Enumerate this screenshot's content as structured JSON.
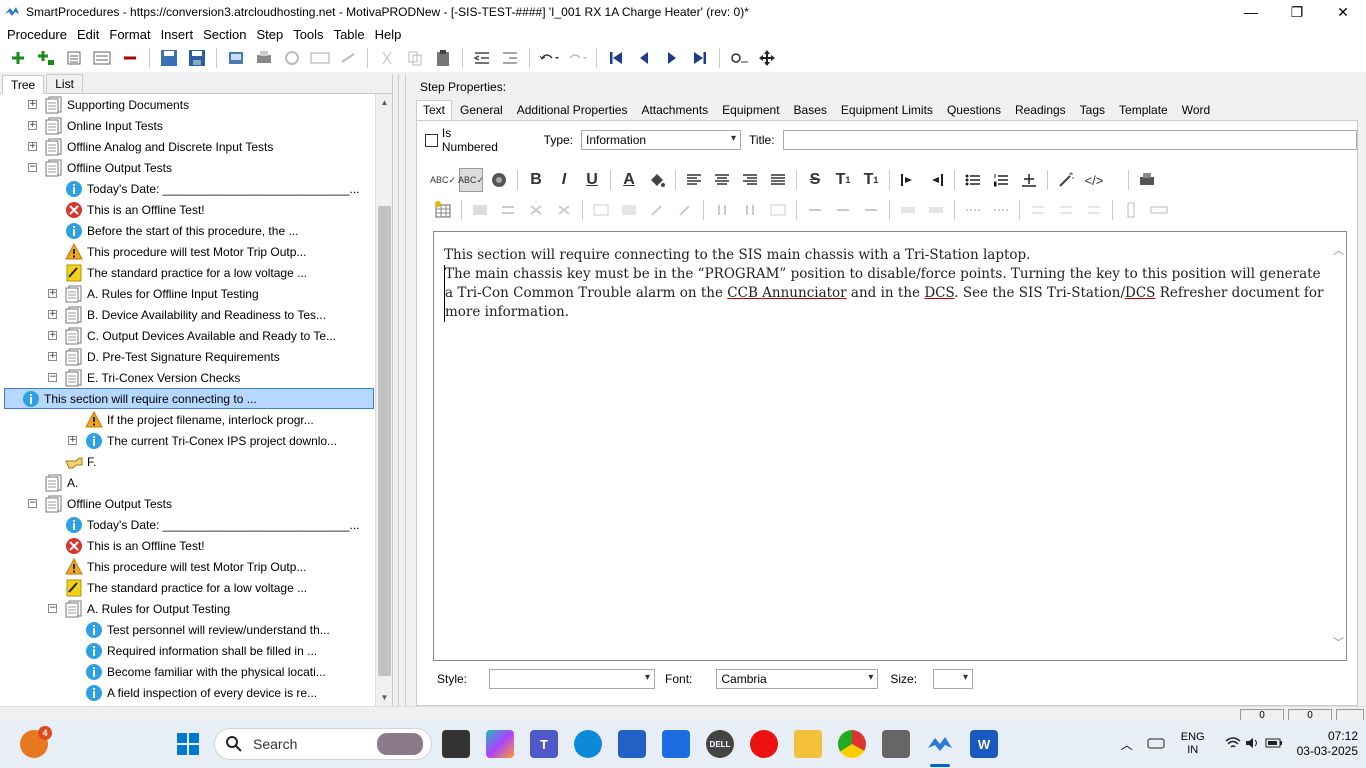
{
  "window": {
    "title": "SmartProcedures - https://conversion3.atrcloudhosting.net - MotivaPRODNew - [-SIS-TEST-####] 'I_001 RX 1A Charge Heater' (rev: 0)*",
    "minimize": "—",
    "maximize": "❐",
    "close": "✕"
  },
  "menu": [
    "Procedure",
    "Edit",
    "Format",
    "Insert",
    "Section",
    "Step",
    "Tools",
    "Table",
    "Help"
  ],
  "left_tabs": [
    "Tree",
    "List"
  ],
  "tree": [
    {
      "level": 1,
      "exp": "+",
      "icon": "doc",
      "label": "Supporting Documents"
    },
    {
      "level": 1,
      "exp": "+",
      "icon": "doc",
      "label": "Online Input Tests"
    },
    {
      "level": 1,
      "exp": "+",
      "icon": "doc",
      "label": "Offline Analog and Discrete Input Tests"
    },
    {
      "level": 1,
      "exp": "−",
      "icon": "doc",
      "label": "Offline Output Tests"
    },
    {
      "level": 2,
      "exp": "",
      "icon": "info",
      "label": "Today's Date: ____________________________..."
    },
    {
      "level": 2,
      "exp": "",
      "icon": "error",
      "label": "This is an Offline Test!"
    },
    {
      "level": 2,
      "exp": "",
      "icon": "info",
      "label": "Before the start of this procedure, the ..."
    },
    {
      "level": 2,
      "exp": "",
      "icon": "warn",
      "label": "This procedure will test Motor Trip Outp..."
    },
    {
      "level": 2,
      "exp": "",
      "icon": "note",
      "label": "The standard practice for a low voltage ..."
    },
    {
      "level": 2,
      "exp": "+",
      "icon": "doc",
      "label": "A. Rules for Offline Input Testing"
    },
    {
      "level": 2,
      "exp": "+",
      "icon": "doc",
      "label": "B. Device Availability and Readiness to Tes..."
    },
    {
      "level": 2,
      "exp": "+",
      "icon": "doc",
      "label": "C. Output Devices Available and Ready to Te..."
    },
    {
      "level": 2,
      "exp": "+",
      "icon": "doc",
      "label": "D. Pre-Test Signature Requirements"
    },
    {
      "level": 2,
      "exp": "−",
      "icon": "doc",
      "label": "E. Tri-Conex Version Checks"
    },
    {
      "level": 3,
      "exp": "",
      "icon": "info",
      "label": "This section will require connecting to ...",
      "selected": true
    },
    {
      "level": 3,
      "exp": "",
      "icon": "warn",
      "label": "If the project filename, interlock progr..."
    },
    {
      "level": 3,
      "exp": "+",
      "icon": "info",
      "label": "The current Tri-Conex IPS project downlo..."
    },
    {
      "level": 2,
      "exp": "",
      "icon": "hand",
      "label": "F."
    },
    {
      "level": 1,
      "exp": "",
      "icon": "doc",
      "label": "A."
    },
    {
      "level": 1,
      "exp": "−",
      "icon": "doc",
      "label": "Offline Output Tests"
    },
    {
      "level": 2,
      "exp": "",
      "icon": "info",
      "label": "Today's Date: ____________________________..."
    },
    {
      "level": 2,
      "exp": "",
      "icon": "error",
      "label": "This is an Offline Test!"
    },
    {
      "level": 2,
      "exp": "",
      "icon": "warn",
      "label": "This procedure will test Motor Trip Outp..."
    },
    {
      "level": 2,
      "exp": "",
      "icon": "note",
      "label": "The standard practice for a low voltage ..."
    },
    {
      "level": 2,
      "exp": "−",
      "icon": "doc",
      "label": "A. Rules for Output Testing"
    },
    {
      "level": 3,
      "exp": "",
      "icon": "info",
      "label": "Test personnel will review/understand th..."
    },
    {
      "level": 3,
      "exp": "",
      "icon": "info",
      "label": "Required information shall be filled in ..."
    },
    {
      "level": 3,
      "exp": "",
      "icon": "info",
      "label": "Become familiar with the physical locati..."
    },
    {
      "level": 3,
      "exp": "",
      "icon": "info",
      "label": "A field inspection of every device is re..."
    }
  ],
  "step_properties": {
    "label": "Step Properties:",
    "tabs": [
      "Text",
      "General",
      "Additional Properties",
      "Attachments",
      "Equipment",
      "Bases",
      "Equipment Limits",
      "Questions",
      "Readings",
      "Tags",
      "Template",
      "Word"
    ],
    "is_numbered_label": "Is Numbered",
    "type_label": "Type:",
    "type_value": "Information",
    "title_label": "Title:",
    "title_value": ""
  },
  "editor": {
    "line1": "This section will require connecting to the SIS main chassis with a Tri-Station laptop.",
    "para2_a": "The main chassis key must be in the “PROGRAM” position to disable/force points. Turning the key to this position will generate a Tri-Con Common Trouble alarm on the ",
    "para2_ccb": "CCB Annunciator",
    "para2_b": " and in the ",
    "para2_dcs": "DCS",
    "para2_c": ". See the SIS Tri-Station/",
    "para2_dcs2": "DCS",
    "para2_d": " Refresher document for more information."
  },
  "format_bar": {
    "style_label": "Style:",
    "style_value": "",
    "font_label": "Font:",
    "font_value": "Cambria",
    "size_label": "Size:",
    "size_value": ""
  },
  "bottom": {
    "page_a": "0",
    "page_b": "0"
  },
  "taskbar": {
    "search_placeholder": "Search",
    "notification_count": "4",
    "lang_line1": "ENG",
    "lang_line2": "IN",
    "time": "07:12",
    "date": "03-03-2025"
  }
}
